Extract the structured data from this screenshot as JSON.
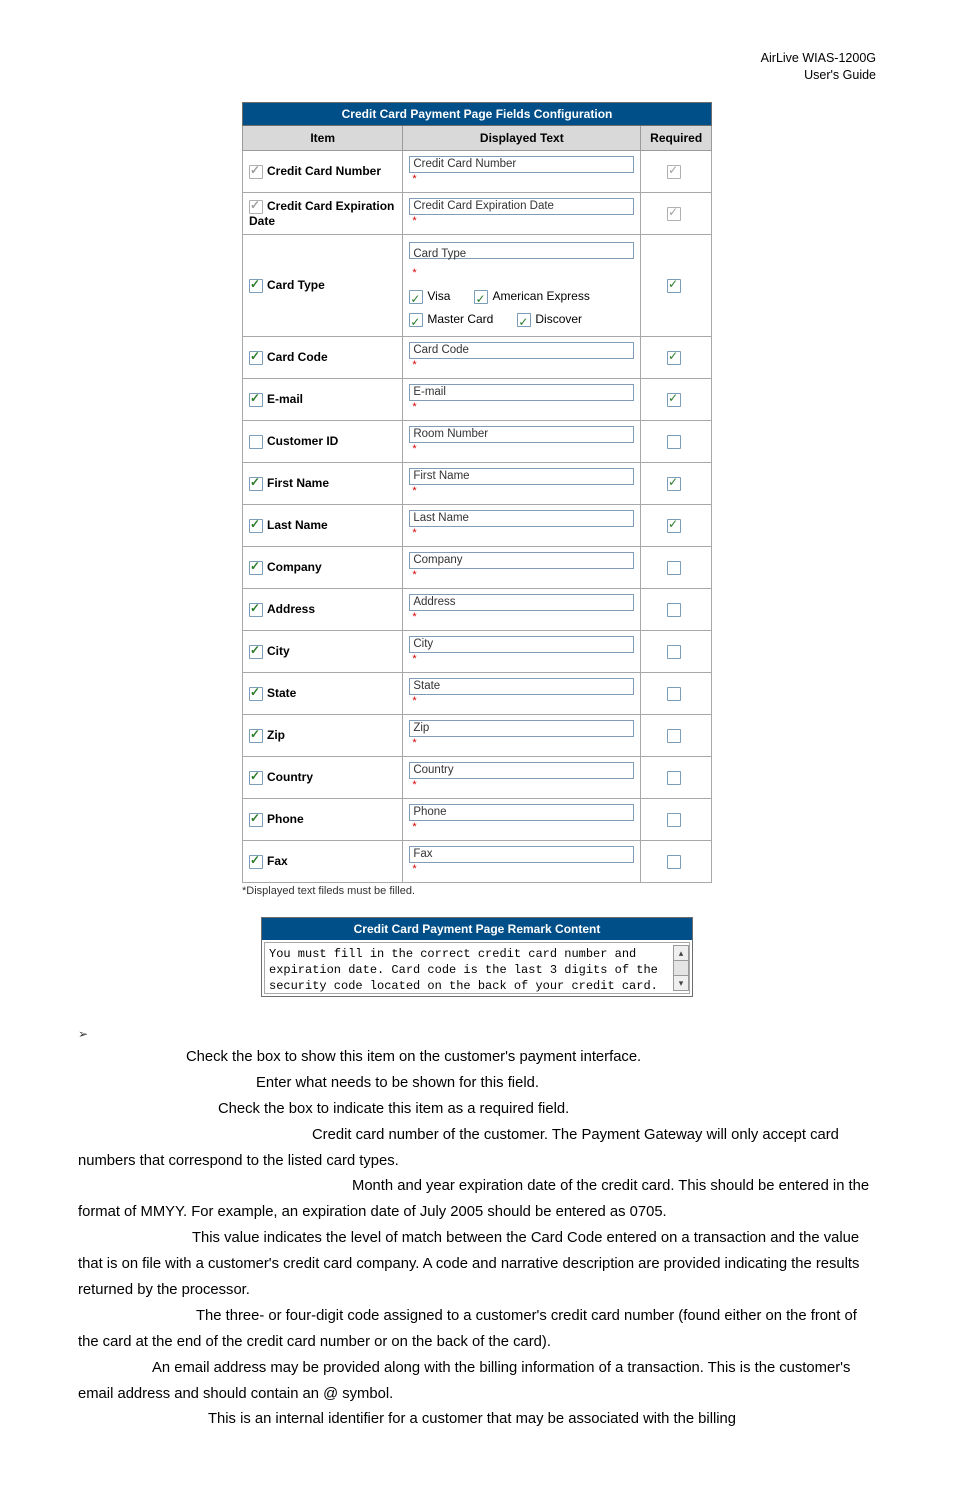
{
  "header": {
    "product": "AirLive WIAS-1200G",
    "doc": "User's Guide"
  },
  "config": {
    "title": "Credit Card Payment Page Fields Configuration",
    "cols": {
      "item": "Item",
      "disp": "Displayed Text",
      "req": "Required"
    },
    "rows": [
      {
        "on": true,
        "grey": true,
        "label": "Credit Card Number",
        "value": "Credit Card Number",
        "req_on": true,
        "req_grey": true
      },
      {
        "on": true,
        "grey": true,
        "label": "Credit Card Expiration Date",
        "value": "Credit Card Expiration Date",
        "req_on": true,
        "req_grey": true
      },
      {
        "on": true,
        "label": "Card Type",
        "value": "Card Type",
        "req_on": true,
        "cardtype": true,
        "opts": [
          {
            "on": true,
            "label": "Visa"
          },
          {
            "on": true,
            "label": "American Express"
          },
          {
            "on": true,
            "label": "Master Card"
          },
          {
            "on": true,
            "label": "Discover"
          }
        ]
      },
      {
        "on": true,
        "label": "Card Code",
        "value": "Card Code",
        "req_on": true
      },
      {
        "on": true,
        "label": "E-mail",
        "value": "E-mail",
        "req_on": true
      },
      {
        "on": false,
        "label": "Customer ID",
        "value": "Room Number",
        "req_on": false
      },
      {
        "on": true,
        "label": "First Name",
        "value": "First Name",
        "req_on": true
      },
      {
        "on": true,
        "label": "Last Name",
        "value": "Last Name",
        "req_on": true
      },
      {
        "on": true,
        "label": "Company",
        "value": "Company",
        "req_on": false
      },
      {
        "on": true,
        "label": "Address",
        "value": "Address",
        "req_on": false
      },
      {
        "on": true,
        "label": "City",
        "value": "City",
        "req_on": false
      },
      {
        "on": true,
        "label": "State",
        "value": "State",
        "req_on": false
      },
      {
        "on": true,
        "label": "Zip",
        "value": "Zip",
        "req_on": false
      },
      {
        "on": true,
        "label": "Country",
        "value": "Country",
        "req_on": false
      },
      {
        "on": true,
        "label": "Phone",
        "value": "Phone",
        "req_on": false
      },
      {
        "on": true,
        "label": "Fax",
        "value": "Fax",
        "req_on": false
      }
    ],
    "footnote": "*Displayed text fileds must be filled."
  },
  "remark": {
    "title": "Credit Card Payment Page Remark Content",
    "text": "You must fill in the correct credit card number and expiration date. Card code is the last 3 digits of the security code located on the back of your credit card. If"
  },
  "body": {
    "p1": "Check the box to show this item on the customer's payment interface.",
    "p2": "Enter what needs to be shown for this field.",
    "p3": "Check the box to indicate this item as a required field.",
    "p4": "Credit card number of the customer. The Payment Gateway will only accept card numbers that correspond to the listed card types.",
    "p5": "Month and year expiration date of the credit card. This should be entered in the format of MMYY. For example, an expiration date of July 2005 should be entered as 0705.",
    "p6": "This value indicates the level of match between the Card Code entered on a transaction and the value that is on file with a customer's credit card company. A code and narrative description are provided indicating the results returned by the processor.",
    "p7": "The three- or four-digit code assigned to a customer's credit card number (found either on the front of the card at the end of the credit card number or on the back of the card).",
    "p8": "An email address may be provided along with the billing information of a transaction. This is the customer's email address and should contain an @ symbol.",
    "p9": "This is an internal identifier for a customer that may be associated with the billing"
  },
  "bullet": "➢"
}
